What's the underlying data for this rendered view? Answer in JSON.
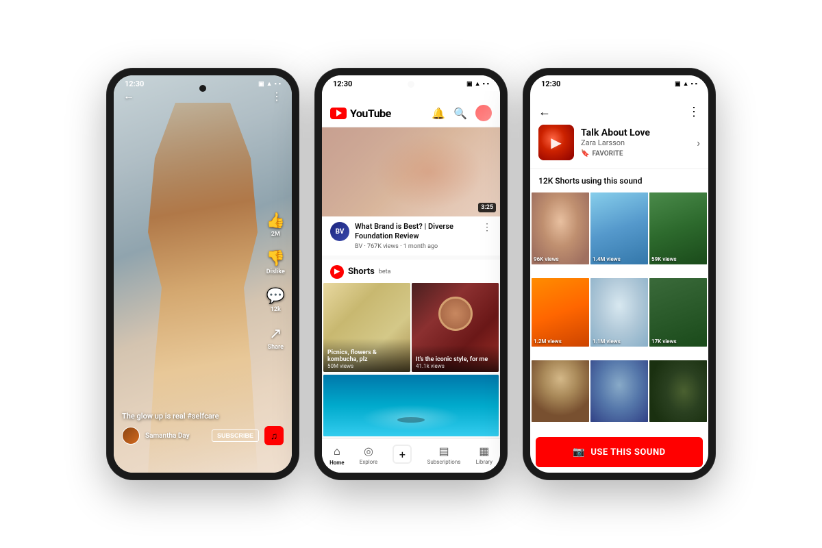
{
  "phone1": {
    "status": {
      "time": "12:30",
      "icons": "▣ ▲ ■"
    },
    "back_icon": "←",
    "more_icon": "⋮",
    "like": {
      "icon": "👍",
      "count": "2M"
    },
    "dislike": {
      "icon": "👎",
      "label": "Dislike"
    },
    "comment": {
      "icon": "💬",
      "count": "12k"
    },
    "share": {
      "icon": "↗",
      "label": "Share"
    },
    "caption": "The glow up is real #selfcare",
    "channel": "Samantha Day",
    "subscribe": "SUBSCRIBE",
    "music_icon": "♫"
  },
  "phone2": {
    "status": {
      "time": "12:30"
    },
    "logo_text": "YouTube",
    "video": {
      "duration": "3:25",
      "title": "What Brand is Best? | Diverse Foundation Review",
      "channel_initial": "BV",
      "meta": "BV · 767K views · 1 month ago"
    },
    "shorts": {
      "title": "Shorts",
      "beta": "beta",
      "item1": {
        "caption": "Picnics, flowers & kombucha, plz",
        "views": "50M views"
      },
      "item2": {
        "caption": "It's the iconic style, for me",
        "views": "41.1k views"
      }
    },
    "nav": {
      "home": "Home",
      "explore": "Explore",
      "subscriptions": "Subscriptions",
      "library": "Library"
    }
  },
  "phone3": {
    "status": {
      "time": "12:30"
    },
    "back_icon": "←",
    "more_icon": "⋮",
    "sound": {
      "title": "Talk About Love",
      "artist": "Zara Larsson",
      "favorite": "FAVORITE"
    },
    "shorts_count": "12K Shorts using this sound",
    "videos": [
      {
        "views": "96K views"
      },
      {
        "views": "1.4M views"
      },
      {
        "views": "59K views"
      },
      {
        "views": "1.2M views"
      },
      {
        "views": "1.1M views"
      },
      {
        "views": "17K views"
      },
      {
        "views": ""
      },
      {
        "views": ""
      },
      {
        "views": ""
      }
    ],
    "use_sound": "USE THIS SOUND",
    "camera_icon": "📷"
  }
}
